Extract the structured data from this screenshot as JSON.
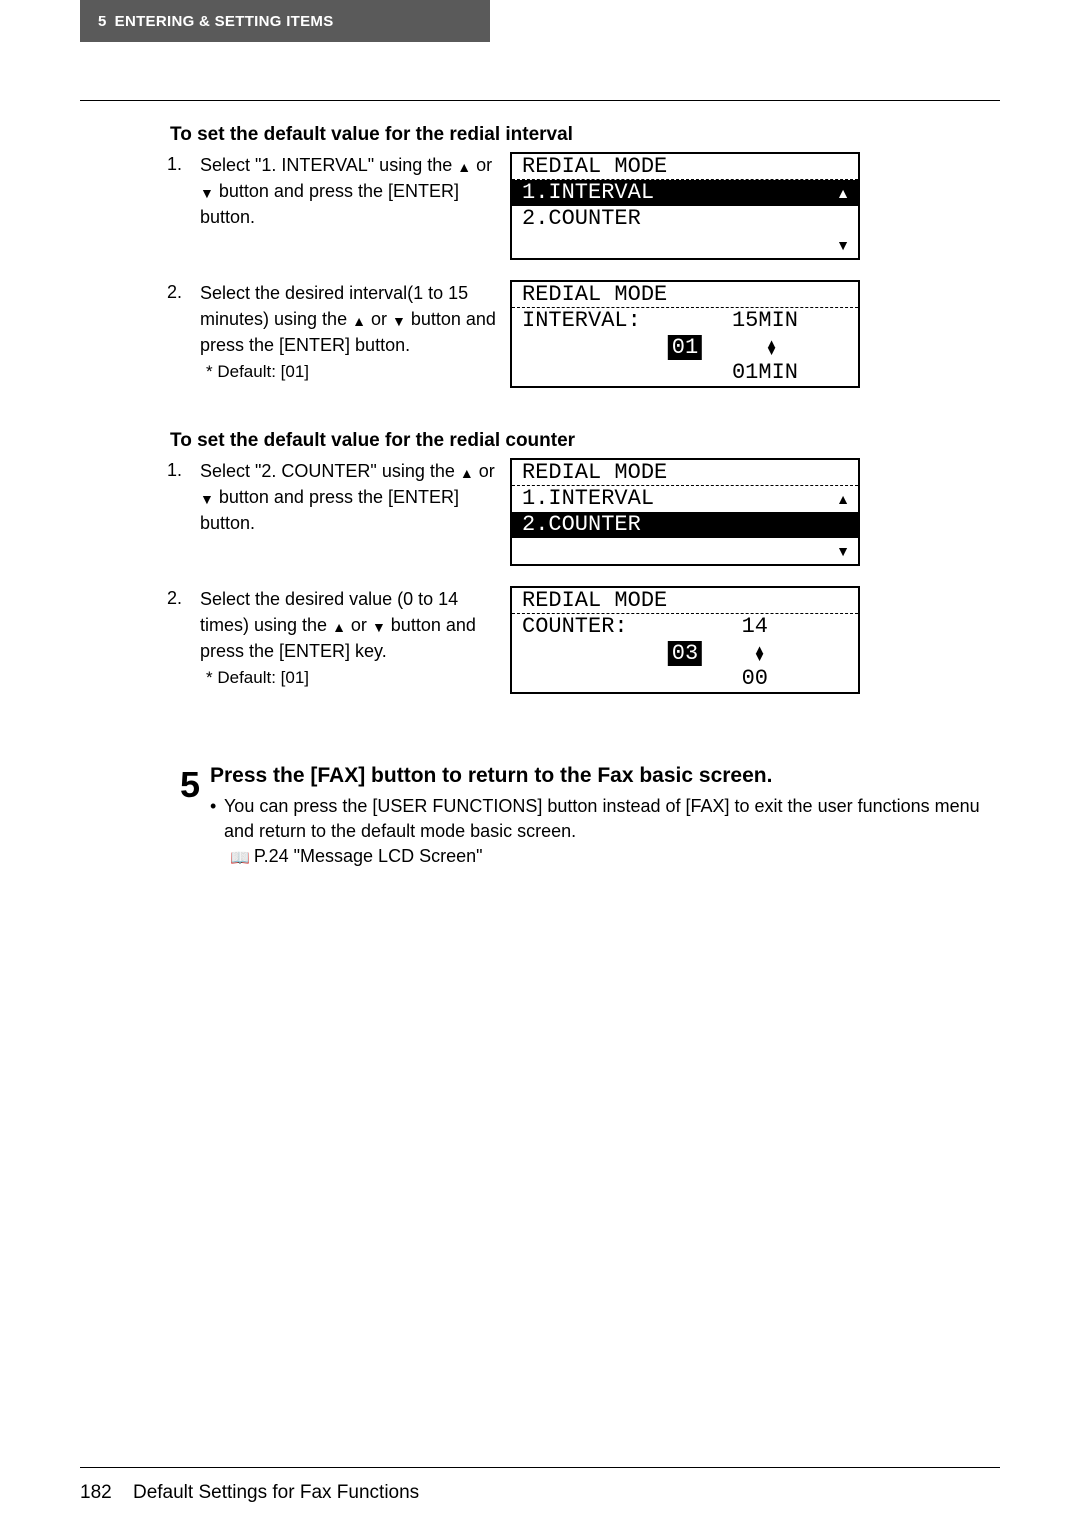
{
  "header": {
    "chapter_num": "5",
    "chapter_title": "ENTERING & SETTING ITEMS"
  },
  "section_interval": {
    "heading": "To set the default value for the redial interval",
    "step1": {
      "num": "1.",
      "text_a": "Select \"1. INTERVAL\" using the ",
      "text_b": " or ",
      "text_c": " button and press the [ENTER] button.",
      "lcd_title": "REDIAL MODE",
      "lcd_item1": "1.INTERVAL",
      "lcd_item2": "2.COUNTER"
    },
    "step2": {
      "num": "2.",
      "text_a": "Select the desired interval(1 to 15 minutes) using the ",
      "text_b": " or ",
      "text_c": " button and press the [ENTER] button.",
      "default_label": "*    Default: [01]",
      "lcd_title": "REDIAL MODE",
      "lcd_label": "INTERVAL:",
      "lcd_max": "15MIN",
      "lcd_val": "01",
      "lcd_min": "01MIN"
    }
  },
  "section_counter": {
    "heading": "To set the default value for the redial counter",
    "step1": {
      "num": "1.",
      "text_a": "Select \"2. COUNTER\" using the ",
      "text_b": " or ",
      "text_c": " button and press the [ENTER] button.",
      "lcd_title": "REDIAL MODE",
      "lcd_item1": "1.INTERVAL",
      "lcd_item2": "2.COUNTER"
    },
    "step2": {
      "num": "2.",
      "text_a": "Select the desired value (0 to 14 times) using the ",
      "text_b": " or ",
      "text_c": " button and press the [ENTER] key.",
      "default_label": "*    Default: [01]",
      "lcd_title": "REDIAL MODE",
      "lcd_label": "COUNTER:",
      "lcd_max": "14",
      "lcd_val": "03",
      "lcd_min": "00"
    }
  },
  "step5": {
    "num": "5",
    "heading": "Press the [FAX] button to return to the Fax basic screen.",
    "bullet": "You can press the [USER FUNCTIONS] button instead of [FAX] to exit the user functions menu and return to the default mode basic screen.",
    "ref": "P.24 \"Message LCD Screen\""
  },
  "footer": {
    "page": "182",
    "title": "Default Settings for Fax Functions"
  }
}
